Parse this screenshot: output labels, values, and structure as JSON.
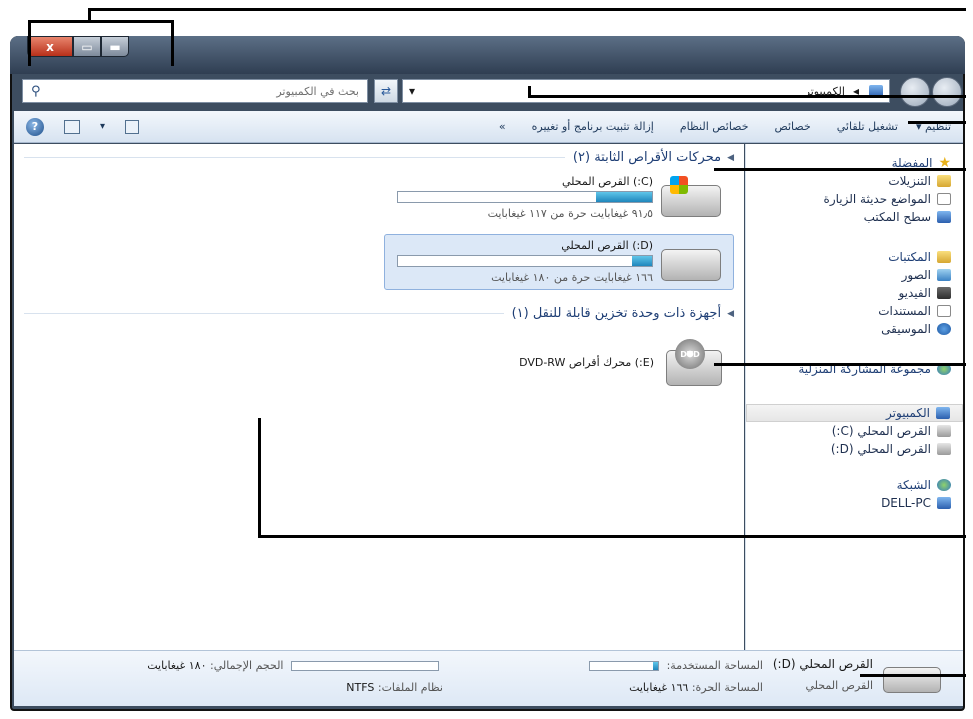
{
  "window": {
    "caption_close": "x",
    "caption_max": "▭",
    "caption_min": "▬"
  },
  "address": {
    "crumb_arrow": "◂",
    "crumb_label": "الكمبيوتر",
    "dropdown": "▾",
    "refresh_icon": "refresh-arrows-icon",
    "search_placeholder": "بحث في الكمبيوتر",
    "search_icon": "magnifier-icon"
  },
  "toolbar": {
    "organize": "تنظيم ▾",
    "autoplay": "تشغيل تلقائي",
    "properties": "خصائص",
    "system_properties": "خصائص النظام",
    "uninstall": "إزالة تثبيت برنامج أو تغييره",
    "more": "»"
  },
  "nav": {
    "favorites": {
      "title": "المفضلة",
      "items": [
        "التنزيلات",
        "المواضع حديثة الزيارة",
        "سطح المكتب"
      ]
    },
    "libraries": {
      "title": "المكتبات",
      "items": [
        "الصور",
        "الفيديو",
        "المستندات",
        "الموسيقى"
      ]
    },
    "homegroup": "مجموعة المشاركة المنزلية",
    "computer": {
      "title": "الكمبيوتر",
      "items": [
        "القرص المحلي (C:)",
        "القرص المحلي (D:)"
      ]
    },
    "network": {
      "title": "الشبكة",
      "items": [
        "DELL-PC"
      ]
    }
  },
  "content": {
    "hdd_header": "محركات الأقراص الثابتة (٢)",
    "removable_header": "أجهزة ذات وحدة تخزين قابلة للنقل (١)",
    "drives": [
      {
        "name": "(C:) القرص المحلي",
        "free": "٩١٫٥ غيغابايت حرة من ١١٧ غيغابايت",
        "used_fraction": 0.22
      },
      {
        "name": "(D:) القرص المحلي",
        "free": "١٦٦ غيغابايت حرة من ١٨٠ غيغابايت",
        "used_fraction": 0.08
      }
    ],
    "dvd": {
      "name": "(E:) محرك أقراص DVD-RW",
      "disc_label": "DVD"
    }
  },
  "details": {
    "title": "القرص المحلي (D:)",
    "type": "القرص المحلي",
    "used_label": "المساحة المستخدمة:",
    "used_fraction": 0.08,
    "free_label": "المساحة الحرة:",
    "free_value": "١٦٦ غيغابايت",
    "total_label": "الحجم الإجمالي:",
    "total_value": "١٨٠ غيغابايت",
    "fs_label": "نظام الملفات:",
    "fs_value": "NTFS"
  }
}
